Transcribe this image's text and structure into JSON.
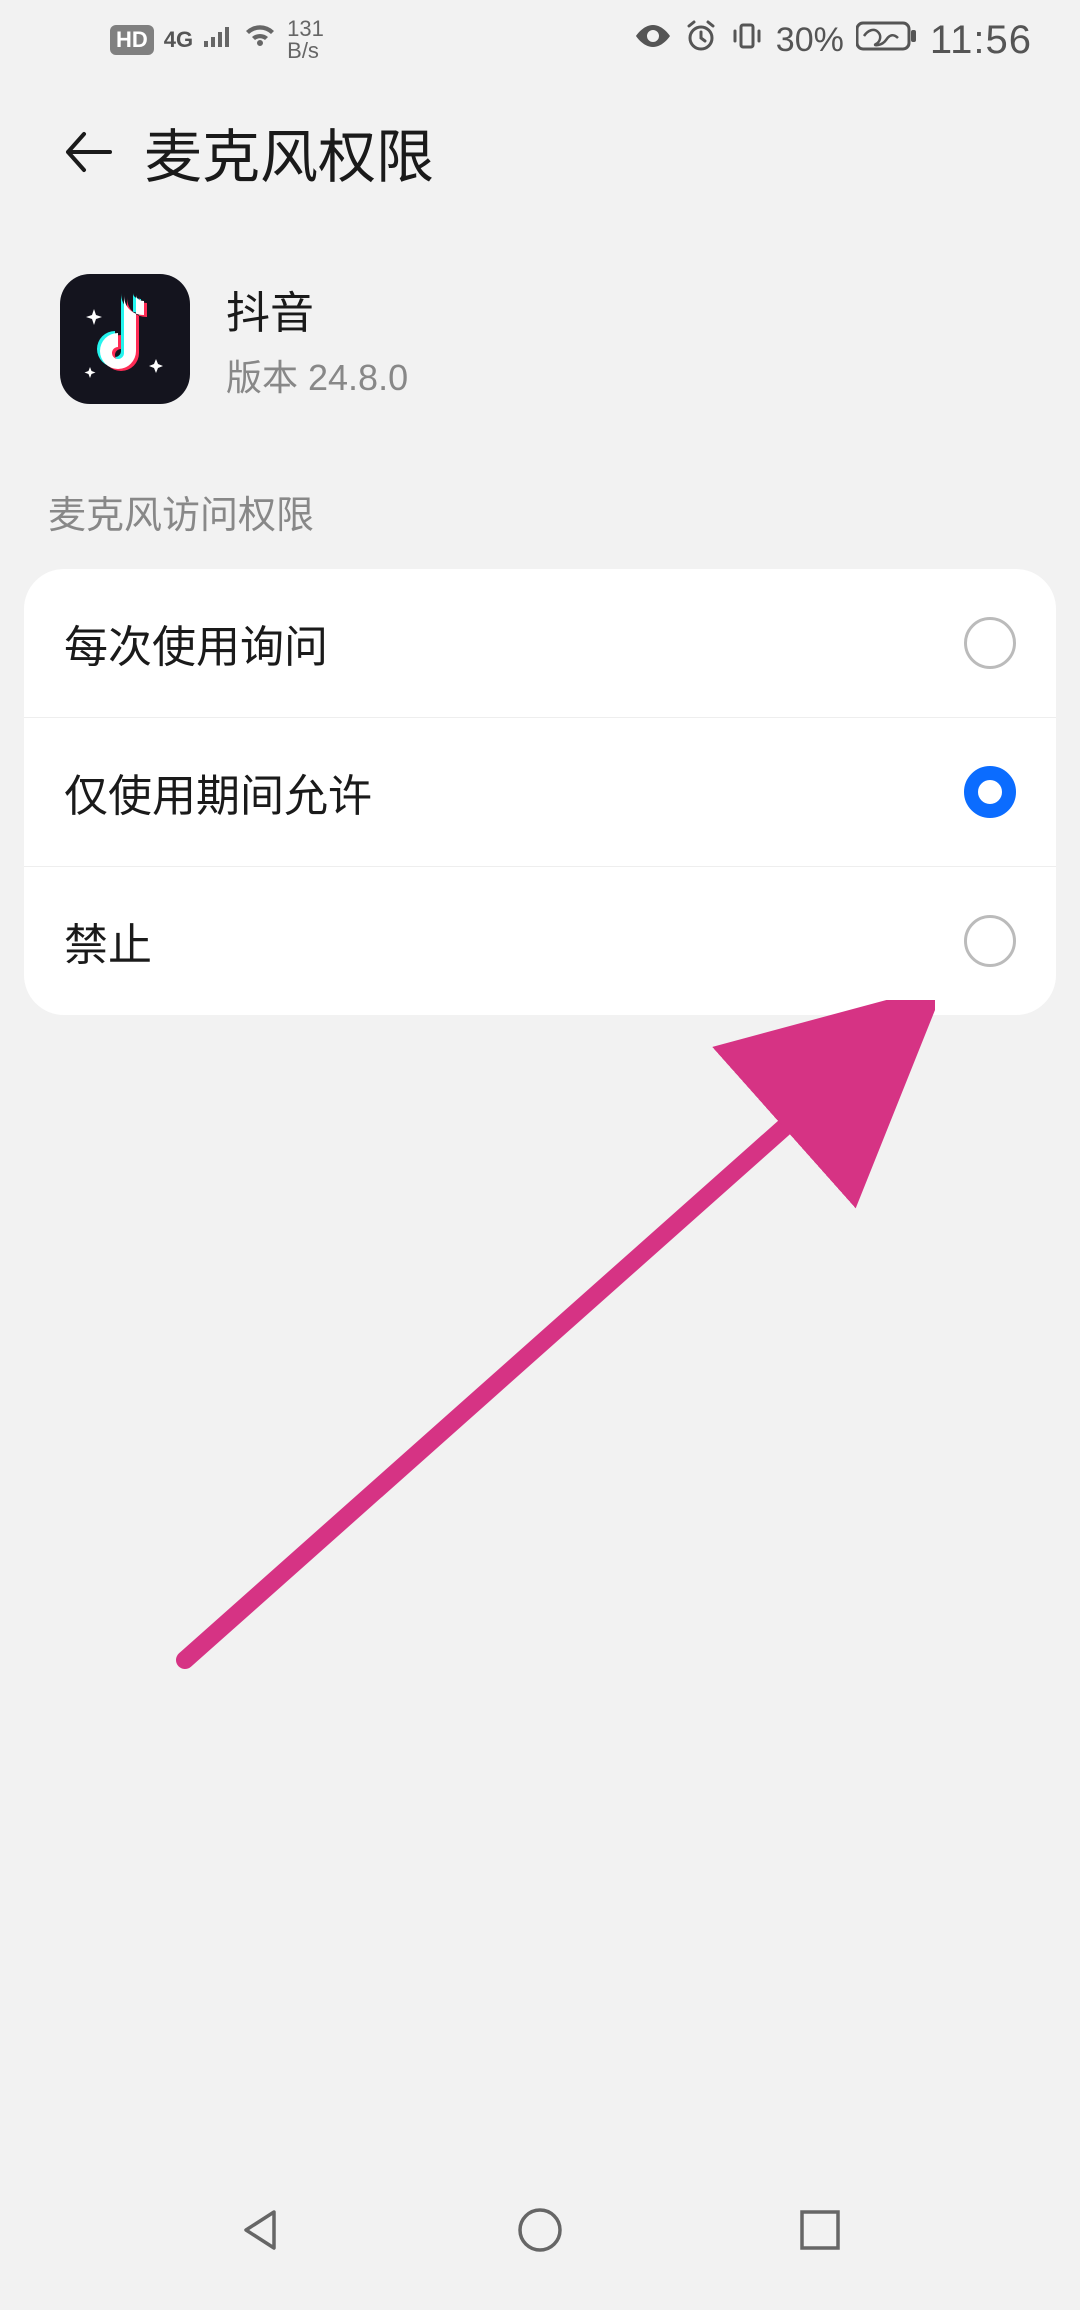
{
  "status_bar": {
    "hd": "HD",
    "net": "4G",
    "speed_top": "131",
    "speed_bottom": "B/s",
    "battery_pct": "30%",
    "time": "11:56"
  },
  "header": {
    "title": "麦克风权限"
  },
  "app": {
    "name": "抖音",
    "version_label": "版本 24.8.0",
    "icon_name": "douyin-icon"
  },
  "section": {
    "label": "麦克风访问权限"
  },
  "options": [
    {
      "label": "每次使用询问",
      "selected": false
    },
    {
      "label": "仅使用期间允许",
      "selected": true
    },
    {
      "label": "禁止",
      "selected": false
    }
  ],
  "annotation": {
    "color": "#d63384"
  }
}
